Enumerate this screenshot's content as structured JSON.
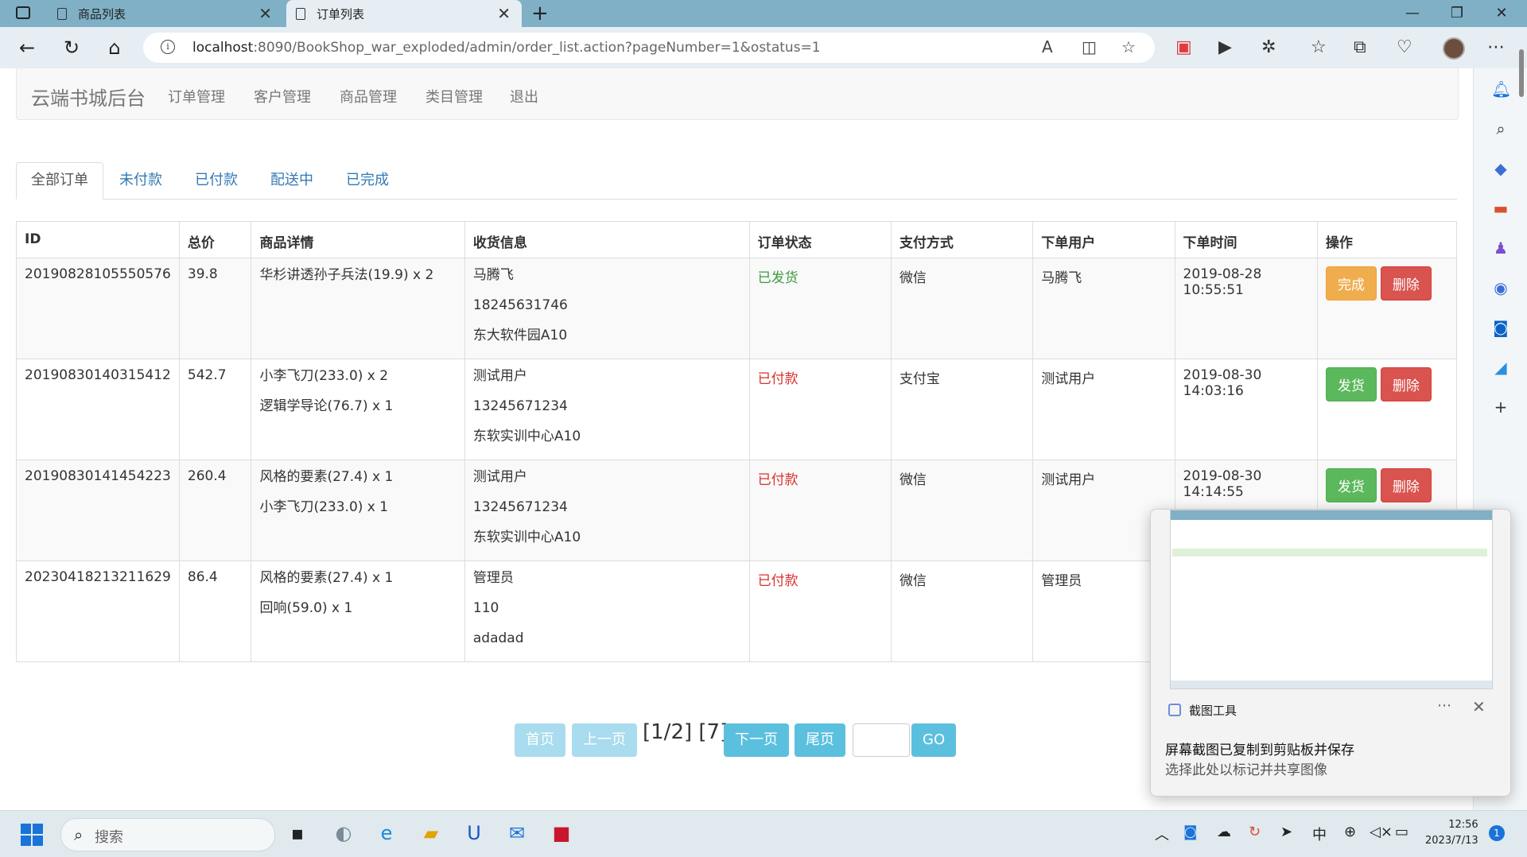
{
  "browser": {
    "tabs": [
      {
        "title": "商品列表",
        "active": false
      },
      {
        "title": "订单列表",
        "active": true
      }
    ],
    "url_host": "localhost",
    "url_rest": ":8090/BookShop_war_exploded/admin/order_list.action?pageNumber=1&ostatus=1"
  },
  "header": {
    "brand": "云端书城后台",
    "nav": [
      "订单管理",
      "客户管理",
      "商品管理",
      "类目管理",
      "退出"
    ]
  },
  "order_tabs": [
    "全部订单",
    "未付款",
    "已付款",
    "配送中",
    "已完成"
  ],
  "table": {
    "headers": [
      "ID",
      "总价",
      "商品详情",
      "收货信息",
      "订单状态",
      "支付方式",
      "下单用户",
      "下单时间",
      "操作"
    ],
    "rows": [
      {
        "id": "20190828105550576",
        "total": "39.8",
        "items": [
          "华杉讲透孙子兵法(19.9) x 2"
        ],
        "recv": [
          "马腾飞",
          "18245631746",
          "东大软件园A10"
        ],
        "status": "已发货",
        "pay": "微信",
        "user": "马腾飞",
        "time": [
          "2019-08-28",
          "10:55:51"
        ],
        "action": "完成",
        "delete": "删除"
      },
      {
        "id": "20190830140315412",
        "total": "542.7",
        "items": [
          "小李飞刀(233.0) x 2",
          "逻辑学导论(76.7) x 1"
        ],
        "recv": [
          "测试用户",
          "13245671234",
          "东软实训中心A10"
        ],
        "status": "已付款",
        "pay": "支付宝",
        "user": "测试用户",
        "time": [
          "2019-08-30",
          "14:03:16"
        ],
        "action": "发货",
        "delete": "删除"
      },
      {
        "id": "20190830141454223",
        "total": "260.4",
        "items": [
          "风格的要素(27.4) x 1",
          "小李飞刀(233.0) x 1"
        ],
        "recv": [
          "测试用户",
          "13245671234",
          "东软实训中心A10"
        ],
        "status": "已付款",
        "pay": "微信",
        "user": "测试用户",
        "time": [
          "2019-08-30",
          "14:14:55"
        ],
        "action": "发货",
        "delete": "删除"
      },
      {
        "id": "20230418213211629",
        "total": "86.4",
        "items": [
          "风格的要素(27.4) x 1",
          "回响(59.0) x 1"
        ],
        "recv": [
          "管理员",
          "110",
          "adadad"
        ],
        "status": "已付款",
        "pay": "微信",
        "user": "管理员",
        "time": [
          "",
          ""
        ],
        "action": "",
        "delete": ""
      }
    ]
  },
  "pagination": {
    "first": "首页",
    "prev": "上一页",
    "info": "[1/2] [7]",
    "next": "下一页",
    "last": "尾页",
    "go": "GO"
  },
  "toast": {
    "app": "截图工具",
    "title": "屏幕截图已复制到剪贴板并保存",
    "subtitle": "选择此处以标记并共享图像"
  },
  "taskbar": {
    "search_placeholder": "搜索",
    "time": "12:56",
    "date": "2023/7/13",
    "ime": "中",
    "notifications": "1"
  },
  "colors": {
    "tabbar": "#7fb0c6",
    "info_btn": "#5bc0de",
    "status_shipped": "#3c9a3c",
    "status_paid": "#d9302c"
  }
}
